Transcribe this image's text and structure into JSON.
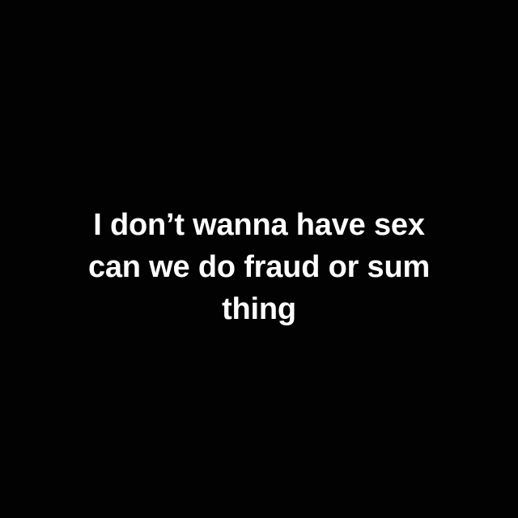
{
  "background_color": "#020202",
  "text_color": "#ffffff",
  "caption": {
    "lines": [
      "I don’t wanna have sex",
      "can we do fraud or sum",
      "thing"
    ]
  }
}
